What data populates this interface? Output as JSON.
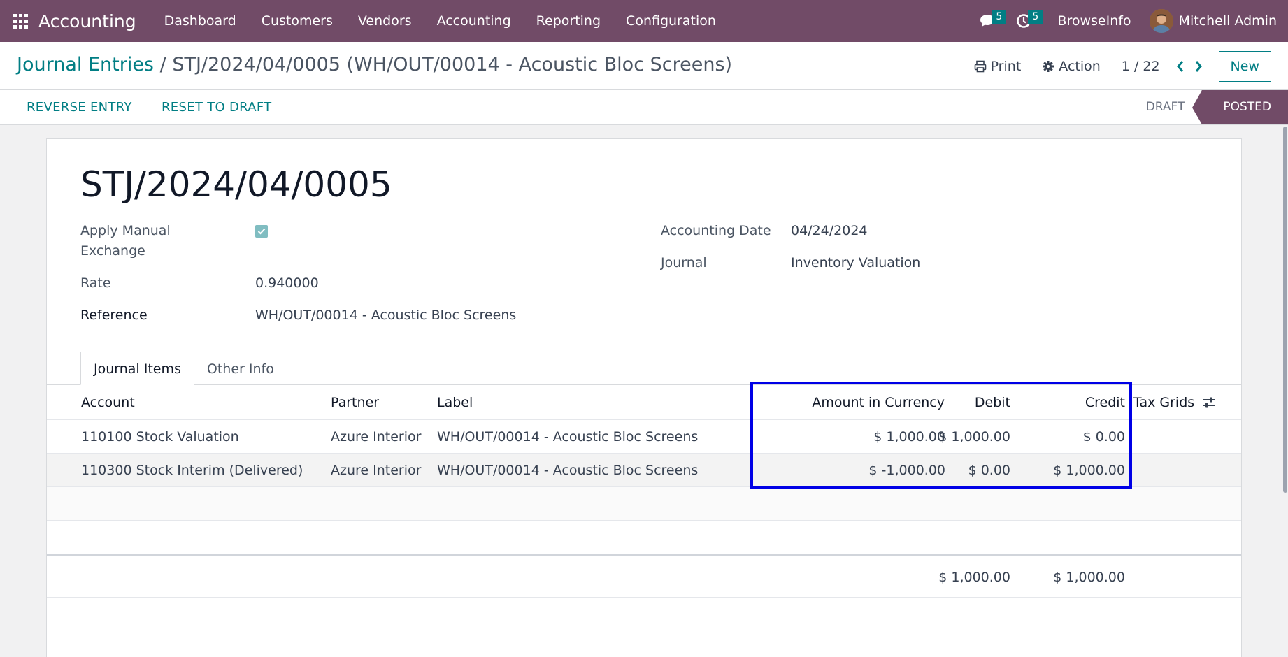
{
  "navbar": {
    "app_name": "Accounting",
    "menu": [
      "Dashboard",
      "Customers",
      "Vendors",
      "Accounting",
      "Reporting",
      "Configuration"
    ],
    "messages_count": "5",
    "activities_count": "5",
    "company": "BrowseInfo",
    "user": "Mitchell Admin"
  },
  "breadcrumb": {
    "root": "Journal Entries",
    "separator": "/",
    "current": "STJ/2024/04/0005 (WH/OUT/00014 - Acoustic Bloc Screens)"
  },
  "control_panel": {
    "print_label": "Print",
    "action_label": "Action",
    "pager": "1 / 22",
    "new_label": "New"
  },
  "status_bar": {
    "buttons": [
      "REVERSE ENTRY",
      "RESET TO DRAFT"
    ],
    "stages": [
      "DRAFT",
      "POSTED"
    ],
    "active_stage": "POSTED"
  },
  "form": {
    "title": "STJ/2024/04/0005",
    "apply_manual_exchange_label_1": "Apply Manual",
    "apply_manual_exchange_label_2": "Exchange",
    "apply_manual_exchange_checked": true,
    "rate_label": "Rate",
    "rate_value": "0.940000",
    "reference_label": "Reference",
    "reference_value": "WH/OUT/00014 - Acoustic Bloc Screens",
    "accounting_date_label": "Accounting Date",
    "accounting_date_value": "04/24/2024",
    "journal_label": "Journal",
    "journal_value": "Inventory Valuation"
  },
  "tabs": [
    "Journal Items",
    "Other Info"
  ],
  "active_tab": "Journal Items",
  "table": {
    "columns": [
      "Account",
      "Partner",
      "Label",
      "Amount in Currency",
      "Debit",
      "Credit",
      "Tax Grids"
    ],
    "rows": [
      {
        "account": "110100 Stock Valuation",
        "partner": "Azure Interior",
        "label": "WH/OUT/00014 - Acoustic Bloc Screens",
        "amount_currency": "$ 1,000.00",
        "debit": "$ 1,000.00",
        "credit": "$ 0.00",
        "tax_grids": ""
      },
      {
        "account": "110300 Stock Interim (Delivered)",
        "partner": "Azure Interior",
        "label": "WH/OUT/00014 - Acoustic Bloc Screens",
        "amount_currency": "$ -1,000.00",
        "debit": "$ 0.00",
        "credit": "$ 1,000.00",
        "tax_grids": ""
      }
    ],
    "totals": {
      "debit": "$ 1,000.00",
      "credit": "$ 1,000.00"
    }
  },
  "colors": {
    "brand": "#714b67",
    "accent": "#017e84",
    "highlight_box": "#0000e6"
  }
}
